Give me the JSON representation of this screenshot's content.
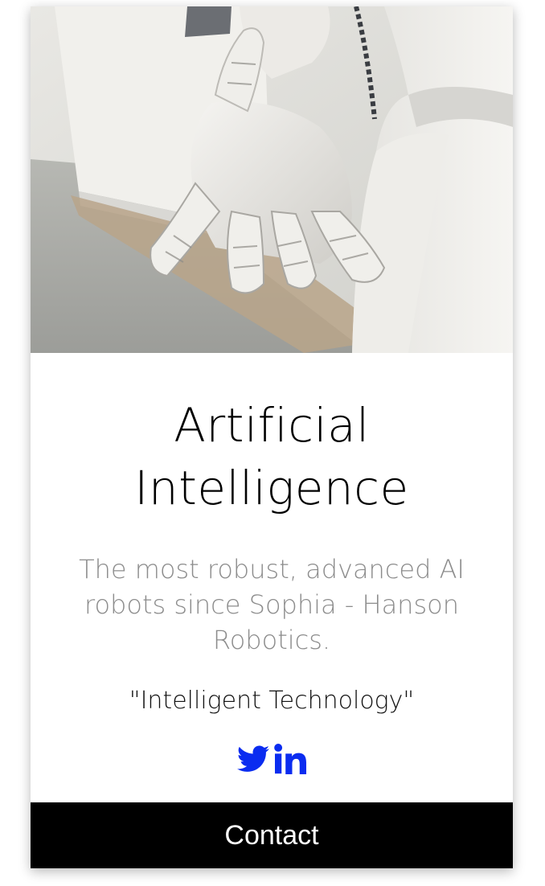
{
  "card": {
    "image_alt": "Robotic hand reaching out",
    "title_line1": "Artificial",
    "title_line2": "Intelligence",
    "description": "The most robust, advanced AI robots since Sophia - Hanson Robotics.",
    "tagline": "\"Intelligent Technology\"",
    "social": {
      "twitter_icon": "twitter-icon",
      "linkedin_icon": "linkedin-icon",
      "icon_color": "#0a2cf0"
    },
    "contact_label": "Contact"
  },
  "colors": {
    "button_bg": "#000000",
    "button_text": "#ffffff",
    "description_text": "#8c8c8c"
  }
}
